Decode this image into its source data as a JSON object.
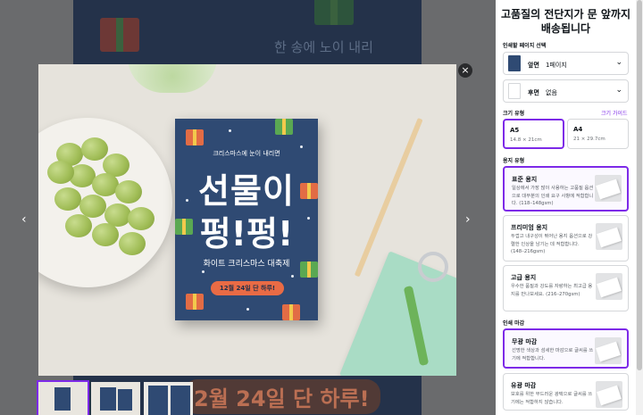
{
  "background": {
    "partial_text": "2월 24일 단 하루!",
    "faint_text": "한 송에 노이 내리"
  },
  "poster": {
    "subtitle": "크리스마스에 눈이 내리면",
    "title_line1": "선물이",
    "title_line2": "펑!펑!",
    "subtitle2": "화이트 크리스마스 대축제",
    "pill": "12월 24일 단 하루!"
  },
  "viewer": {
    "close_icon": "×",
    "prev_icon": "‹",
    "next_icon": "›",
    "thumbnail_count": 3
  },
  "panel": {
    "title_line1": "고품질의 전단지가 문 앞까지",
    "title_line2": "배송됩니다",
    "page_select_label": "인쇄할 페이지 선택",
    "front": {
      "label": "앞면",
      "value": "1페이지"
    },
    "back": {
      "label": "후면",
      "value": "없음"
    },
    "size_label": "크기 유형",
    "size_guide": "크기 가이드",
    "sizes": [
      {
        "name": "A5",
        "dim": "14.8 × 21cm",
        "selected": true
      },
      {
        "name": "A4",
        "dim": "21 × 29.7cm",
        "selected": false
      }
    ],
    "paper_label": "용지 유형",
    "papers": [
      {
        "name": "표준 용지",
        "desc": "일상에서 가장 많이 사용하는 고품질 옵션으로 대부분의 인쇄 요구 사항에 적합합니다. (118–148gsm)",
        "selected": true
      },
      {
        "name": "프리미엄 용지",
        "desc": "두껍고 내구성이 뛰어난 용지 옵션으로 강렬한 인상을 남기는 데 적합합니다. (148–216gsm)",
        "selected": false
      },
      {
        "name": "고급 용지",
        "desc": "우수한 품질과 강도를 자랑하는 최고급 용지를 만나보세요. (216–270gsm)",
        "selected": false
      }
    ],
    "finish_label": "인쇄 마감",
    "finishes": [
      {
        "name": "무광 마감",
        "desc": "선명한 색상과 섬세한 마감으로 글씨를 쓰기에 적합합니다.",
        "selected": true
      },
      {
        "name": "유광 마감",
        "desc": "보호를 위한 부드러운 광택으로 글씨를 쓰기에는 적합하지 않습니다.",
        "selected": false
      }
    ]
  },
  "colors": {
    "accent": "#7d2ae8",
    "poster_bg": "#2f4a73",
    "pill": "#e96b45"
  }
}
